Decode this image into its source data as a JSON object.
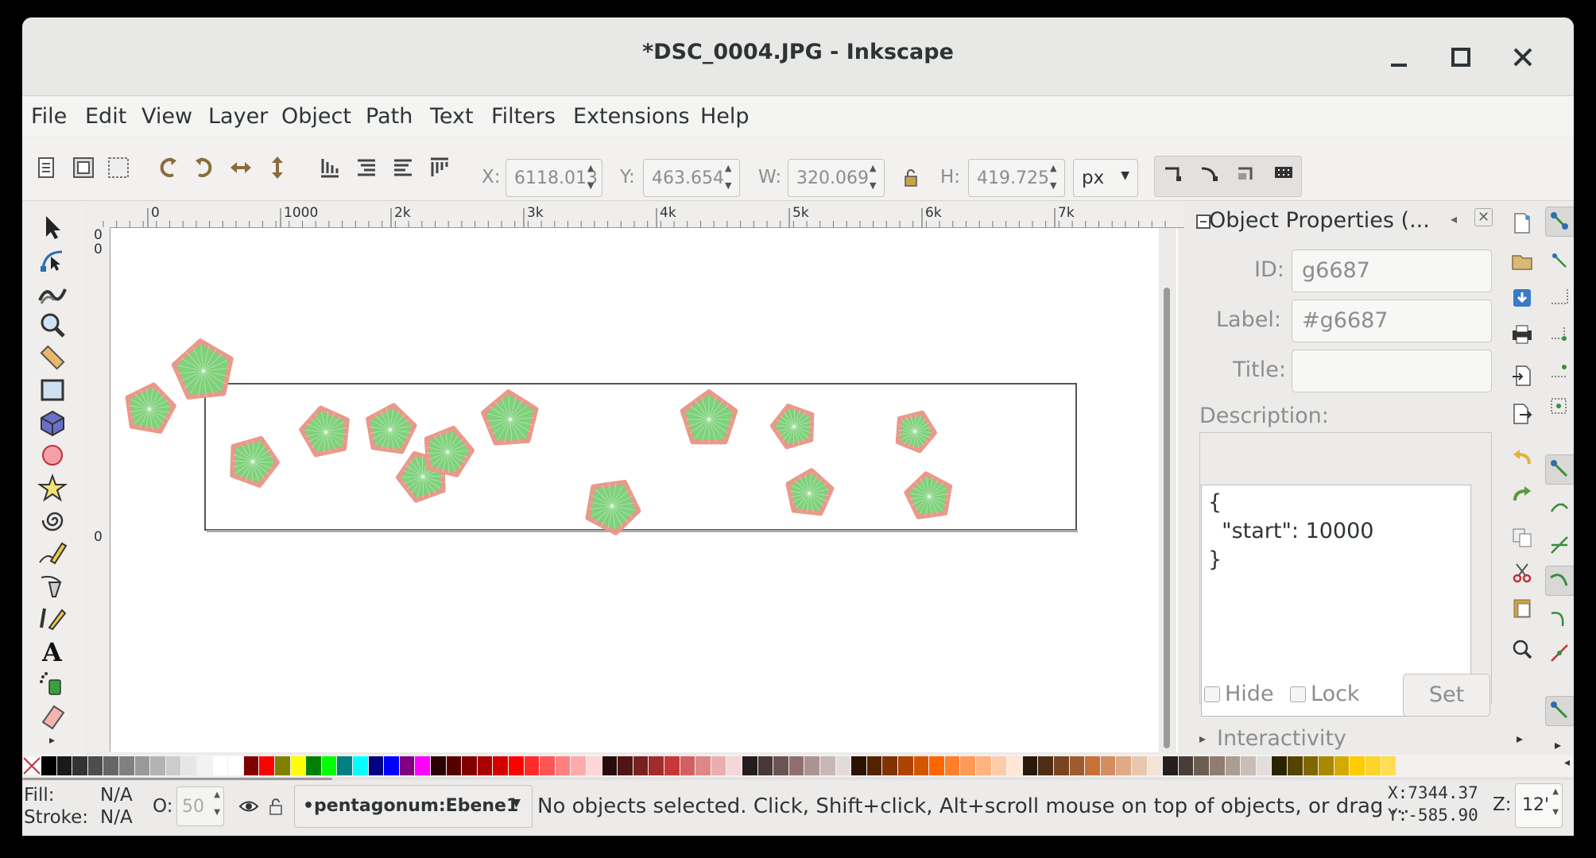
{
  "window": {
    "title": "*DSC_0004.JPG - Inkscape"
  },
  "menu": [
    "File",
    "Edit",
    "View",
    "Layer",
    "Object",
    "Path",
    "Text",
    "Filters",
    "Extensions",
    "Help"
  ],
  "toolbar": {
    "x_label": "X:",
    "x_value": "6118.013",
    "y_label": "Y:",
    "y_value": "463.654",
    "w_label": "W:",
    "w_value": "320.069",
    "h_label": "H:",
    "h_value": "419.725",
    "unit": "px"
  },
  "ruler": {
    "top_labels": [
      "0",
      "1000",
      "2k",
      "3k",
      "4k",
      "5k",
      "6k",
      "7k"
    ],
    "left_labels": [
      "0",
      "0",
      "0"
    ]
  },
  "panel": {
    "title": "Object Properties (...",
    "id_label": "ID:",
    "id_value": "g6687",
    "label_label": "Label:",
    "label_value": "#g6687",
    "title_label": "Title:",
    "title_value": "",
    "description_label": "Description:",
    "description_value": "{\n  \"start\": 10000\n}",
    "hide_label": "Hide",
    "lock_label": "Lock",
    "set_label": "Set",
    "interactivity_label": "Interactivity"
  },
  "status": {
    "fill_label": "Fill:",
    "fill_value": "N/A",
    "stroke_label": "Stroke:",
    "stroke_value": "N/A",
    "opacity_label": "O:",
    "opacity_value": "50",
    "layer": "•pentagonum:Ebene1",
    "message": "No objects selected. Click, Shift+click, Alt+scroll mouse on top of objects, or drag ...",
    "cursor_x": "X:7344.37",
    "cursor_y": "Y:-585.90",
    "zoom_label": "Z:",
    "zoom_value": "12'"
  },
  "colors": {
    "pentagon_fill": "#7fd17c",
    "pentagon_stroke": "#e8998a",
    "accent_green": "#3a8d3a"
  }
}
